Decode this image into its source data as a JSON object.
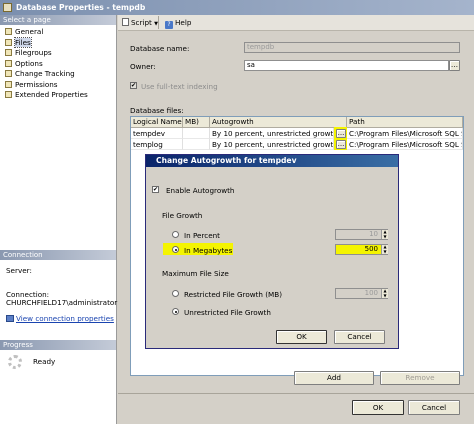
{
  "window": {
    "title": "Database Properties - tempdb"
  },
  "left_pane": {
    "select_page_header": "Select a page",
    "pages": [
      "General",
      "Files",
      "Filegroups",
      "Options",
      "Change Tracking",
      "Permissions",
      "Extended Properties"
    ],
    "selected_index": 1,
    "connection_header": "Connection",
    "server_label": "Server:",
    "server_value": "",
    "connection_label": "Connection:",
    "connection_value": "CHURCHFIELD17\\administrator",
    "view_connection_link": "View connection properties",
    "progress_header": "Progress",
    "progress_status": "Ready"
  },
  "toolbar": {
    "script_label": "Script",
    "help_label": "Help"
  },
  "form": {
    "database_name_label": "Database name:",
    "database_name_value": "tempdb",
    "owner_label": "Owner:",
    "owner_value": "sa",
    "fulltext_label": "Use full-text indexing",
    "database_files_label": "Database files:"
  },
  "files_table": {
    "headers": [
      "Logical Name",
      "MB)",
      "Autogrowth",
      "Path"
    ],
    "rows": [
      {
        "name": "tempdev",
        "autogrowth": "By 10 percent, unrestricted growth",
        "path": "C:\\Program Files\\Microsoft SQL S"
      },
      {
        "name": "templog",
        "autogrowth": "By 10 percent, unrestricted growth",
        "path": "C:\\Program Files\\Microsoft SQL S"
      }
    ],
    "ellipsis_label": "..."
  },
  "dialog": {
    "title": "Change Autogrowth for tempdev",
    "enable_label": "Enable Autogrowth",
    "file_growth_label": "File Growth",
    "in_percent_label": "In Percent",
    "in_percent_value": "10",
    "in_megabytes_label": "In Megabytes",
    "in_megabytes_value": "500",
    "max_file_size_label": "Maximum File Size",
    "restricted_label": "Restricted File Growth (MB)",
    "restricted_value": "100",
    "unrestricted_label": "Unrestricted File Growth",
    "ok_label": "OK",
    "cancel_label": "Cancel"
  },
  "main_buttons": {
    "add_label": "Add",
    "remove_label": "Remove",
    "ok_label": "OK",
    "cancel_label": "Cancel"
  },
  "colors": {
    "highlight": "#f4f400",
    "title_gradient_start": "#7b8fae",
    "dialog_title": "#0a246a"
  }
}
